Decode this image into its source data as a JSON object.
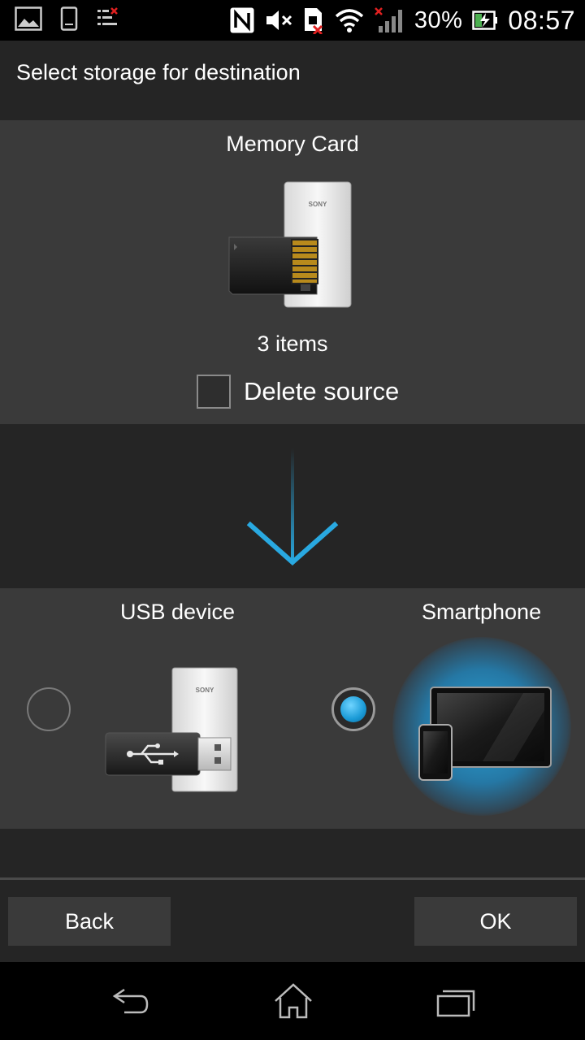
{
  "status_bar": {
    "left_icons": [
      "gallery-icon",
      "phone-storage-icon",
      "sync-error-icon"
    ],
    "right_icons": [
      "nfc-icon",
      "mute-icon",
      "no-sim-icon",
      "wifi-icon",
      "signal-icon"
    ],
    "battery": "30%",
    "time": "08:57"
  },
  "header": {
    "title": "Select storage for destination"
  },
  "source": {
    "label": "Memory Card",
    "image": "memory-card-icon",
    "count": "3 items",
    "delete_label": "Delete source",
    "delete_checked": false
  },
  "destinations": [
    {
      "label": "USB device",
      "image": "usb-drive-icon",
      "selected": false
    },
    {
      "label": "Smartphone",
      "image": "smartphone-tablet-icon",
      "selected": true
    }
  ],
  "buttons": {
    "back": "Back",
    "ok": "OK"
  },
  "colors": {
    "accent": "#29a9e1",
    "panel": "#3a3a3a",
    "band": "#252525"
  },
  "nav_icons": [
    "back-icon",
    "home-icon",
    "recent-apps-icon"
  ]
}
